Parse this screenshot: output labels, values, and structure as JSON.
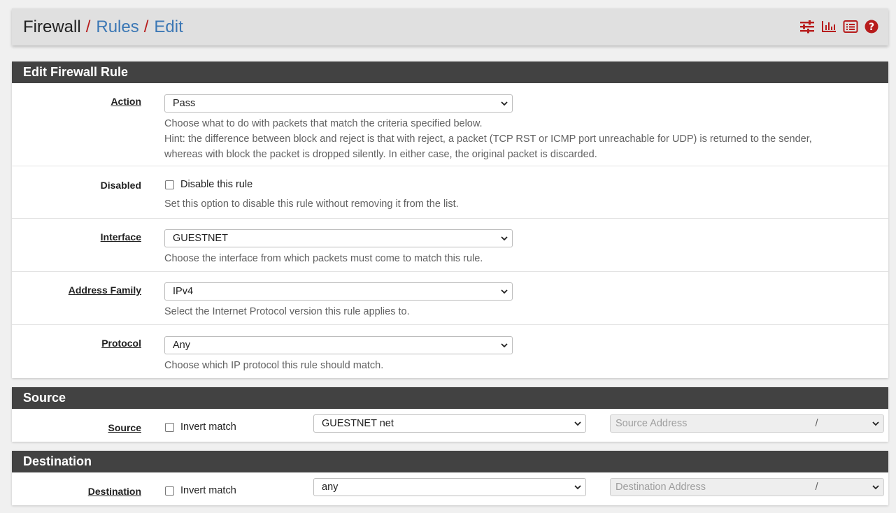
{
  "breadcrumb": {
    "items": [
      "Firewall",
      "Rules",
      "Edit"
    ],
    "separator": "/"
  },
  "toolbar_icons": [
    "sliders-icon",
    "bar-chart-icon",
    "list-icon",
    "help-icon"
  ],
  "colors": {
    "accent_red": "#b71c1c",
    "link_blue": "#3c78b5",
    "panel_heading": "#424242"
  },
  "edit_panel": {
    "title": "Edit Firewall Rule",
    "action": {
      "label": "Action",
      "value": "Pass",
      "help1": "Choose what to do with packets that match the criteria specified below.",
      "help2": "Hint: the difference between block and reject is that with reject, a packet (TCP RST or ICMP port unreachable for UDP) is returned to the sender,",
      "help3": "whereas with block the packet is dropped silently. In either case, the original packet is discarded."
    },
    "disabled": {
      "label": "Disabled",
      "checkbox_label": "Disable this rule",
      "checked": false,
      "help": "Set this option to disable this rule without removing it from the list."
    },
    "interface": {
      "label": "Interface",
      "value": "GUESTNET",
      "help": "Choose the interface from which packets must come to match this rule."
    },
    "address_family": {
      "label": "Address Family",
      "value": "IPv4",
      "help": "Select the Internet Protocol version this rule applies to."
    },
    "protocol": {
      "label": "Protocol",
      "value": "Any",
      "help": "Choose which IP protocol this rule should match."
    }
  },
  "source_panel": {
    "title": "Source",
    "label": "Source",
    "invert_label": "Invert match",
    "invert_checked": false,
    "type_value": "GUESTNET net",
    "address_placeholder": "Source Address",
    "slash": "/",
    "mask_value": ""
  },
  "destination_panel": {
    "title": "Destination",
    "label": "Destination",
    "invert_label": "Invert match",
    "invert_checked": false,
    "type_value": "any",
    "address_placeholder": "Destination Address",
    "slash": "/",
    "mask_value": ""
  }
}
